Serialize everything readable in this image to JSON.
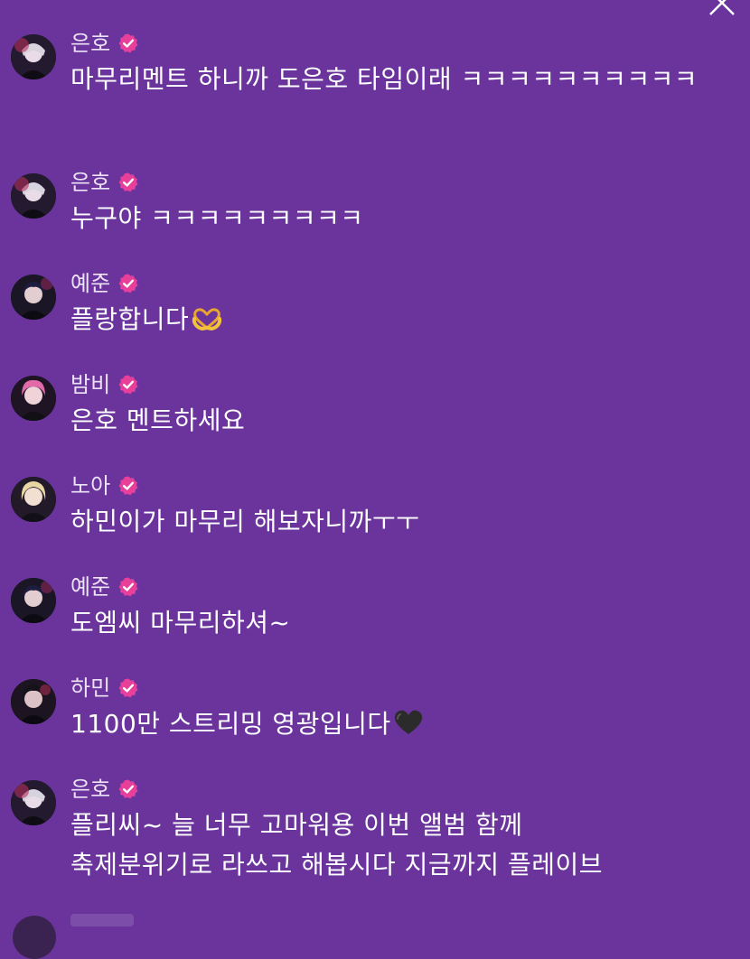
{
  "messages": [
    {
      "name": "은호",
      "text": "마무리멘트 하니까 도은호 타임이래 ㅋㅋㅋㅋㅋㅋㅋㅋㅋㅋ",
      "avatar": "eunho-avatar"
    },
    {
      "name": "은호",
      "text": "누구야 ㅋㅋㅋㅋㅋㅋㅋㅋㅋ",
      "avatar": "eunho-avatar"
    },
    {
      "name": "예준",
      "text": "플랑합니다",
      "emoji": "heart-hands-icon",
      "avatar": "yejun-avatar"
    },
    {
      "name": "밤비",
      "text": "은호 멘트하세요",
      "avatar": "bambi-avatar"
    },
    {
      "name": "노아",
      "text": "하민이가 마무리 해보자니까ㅜㅜ",
      "avatar": "noah-avatar"
    },
    {
      "name": "예준",
      "text": "도엠씨 마무리하셔~",
      "avatar": "yejun-avatar"
    },
    {
      "name": "하민",
      "text": "1100만 스트리밍 영광입니다",
      "emoji": "black-heart-icon",
      "avatar": "hamin-avatar"
    },
    {
      "name": "은호",
      "text": "플리씨~ 늘 너무 고마워용 이번 앨범 함께\n축제분위기로 라쓰고 해봅시다 지금까지 플레이브",
      "avatar": "eunho-avatar"
    }
  ],
  "icons": {
    "verified": "verified-badge-icon",
    "close": "close-icon"
  },
  "colors": {
    "background": "#6a349c",
    "name_text": "#ece2f6",
    "message_text": "#ffffff",
    "badge": "#e8409a"
  }
}
